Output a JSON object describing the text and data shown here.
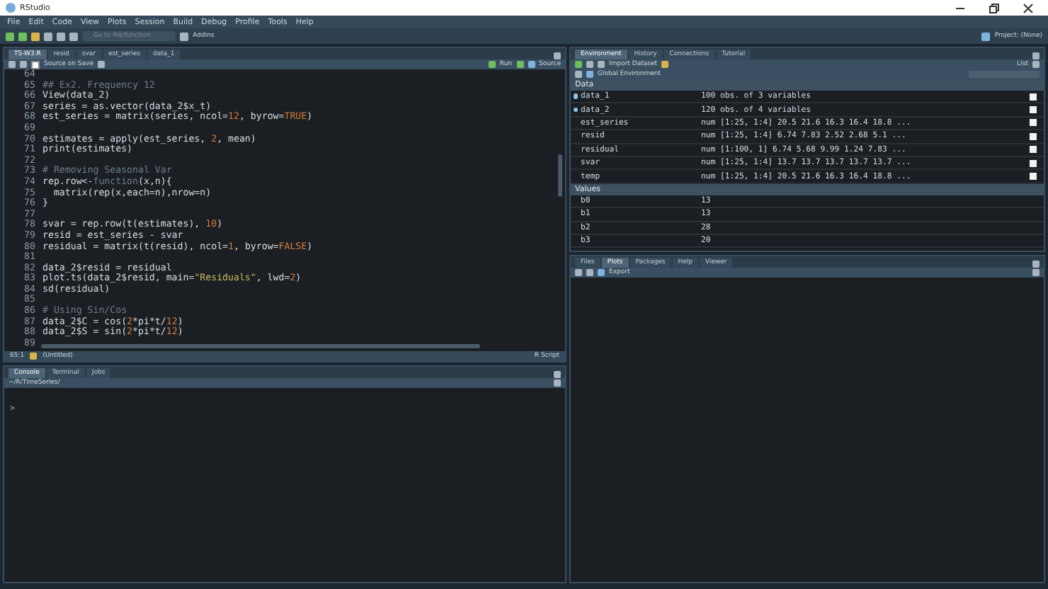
{
  "window": {
    "title": "RStudio"
  },
  "menu": [
    "File",
    "Edit",
    "Code",
    "View",
    "Plots",
    "Session",
    "Build",
    "Debug",
    "Profile",
    "Tools",
    "Help"
  ],
  "toolbar": {
    "goto_placeholder": "Go to file/function",
    "addins": "Addins",
    "project": "Project: (None)"
  },
  "editor": {
    "tabs": [
      {
        "label": "TS-W3.R",
        "selected": true
      },
      {
        "label": "resid",
        "selected": false
      },
      {
        "label": "svar",
        "selected": false
      },
      {
        "label": "est_series",
        "selected": false
      },
      {
        "label": "data_1",
        "selected": false
      }
    ],
    "source_on_save": "Source on Save",
    "source_on_save_checked": false,
    "run": "Run",
    "source": "Source",
    "lines": [
      {
        "n": "64"
      },
      {
        "n": "65",
        "seg": [
          {
            "t": "## Ex2. Frequency 12",
            "kind": "comment"
          }
        ]
      },
      {
        "n": "66",
        "seg": [
          {
            "t": "View(data_2)",
            "kind": "code"
          }
        ]
      },
      {
        "n": "67",
        "seg": [
          {
            "t": "series = as.vector(data_2$x_t)",
            "kind": "code"
          }
        ]
      },
      {
        "n": "68",
        "seg": [
          {
            "t": "est_series = matrix(series, ncol=",
            "kind": "code"
          },
          {
            "t": "12",
            "kind": "number"
          },
          {
            "t": ", byrow=",
            "kind": "code"
          },
          {
            "t": "TRUE",
            "kind": "constant"
          },
          {
            "t": ")",
            "kind": "code"
          }
        ]
      },
      {
        "n": "69"
      },
      {
        "n": "70",
        "seg": [
          {
            "t": "estimates = apply(est_series, ",
            "kind": "code"
          },
          {
            "t": "2",
            "kind": "number"
          },
          {
            "t": ", mean)",
            "kind": "code"
          }
        ]
      },
      {
        "n": "71",
        "seg": [
          {
            "t": "print(estimates)",
            "kind": "code"
          }
        ]
      },
      {
        "n": "72"
      },
      {
        "n": "73",
        "seg": [
          {
            "t": "# Removing Seasonal Var",
            "kind": "comment"
          }
        ]
      },
      {
        "n": "74",
        "seg": [
          {
            "t": "rep.row<-",
            "kind": "code"
          },
          {
            "t": "function",
            "kind": "comment"
          },
          {
            "t": "(x,n){",
            "kind": "code"
          }
        ]
      },
      {
        "n": "75",
        "seg": [
          {
            "t": "  matrix(rep(x,each=n),nrow=n)",
            "kind": "code"
          }
        ]
      },
      {
        "n": "76",
        "seg": [
          {
            "t": "}",
            "kind": "code"
          }
        ]
      },
      {
        "n": "77"
      },
      {
        "n": "78",
        "seg": [
          {
            "t": "svar = rep.row(t(estimates), ",
            "kind": "code"
          },
          {
            "t": "10",
            "kind": "number"
          },
          {
            "t": ")",
            "kind": "code"
          }
        ]
      },
      {
        "n": "79",
        "seg": [
          {
            "t": "resid = est_series - svar",
            "kind": "code"
          }
        ]
      },
      {
        "n": "80",
        "seg": [
          {
            "t": "residual = matrix(t(resid), ncol=",
            "kind": "code"
          },
          {
            "t": "1",
            "kind": "number"
          },
          {
            "t": ", byrow=",
            "kind": "code"
          },
          {
            "t": "FALSE",
            "kind": "constant"
          },
          {
            "t": ")",
            "kind": "code"
          }
        ]
      },
      {
        "n": "81"
      },
      {
        "n": "82",
        "seg": [
          {
            "t": "data_2$resid = residual",
            "kind": "code"
          }
        ]
      },
      {
        "n": "83",
        "seg": [
          {
            "t": "plot.ts(data_2$resid, main=",
            "kind": "code"
          },
          {
            "t": "\"Residuals\"",
            "kind": "string"
          },
          {
            "t": ", lwd=",
            "kind": "code"
          },
          {
            "t": "2",
            "kind": "number"
          },
          {
            "t": ")",
            "kind": "code"
          }
        ]
      },
      {
        "n": "84",
        "seg": [
          {
            "t": "sd(residual)",
            "kind": "code"
          }
        ]
      },
      {
        "n": "85"
      },
      {
        "n": "86",
        "seg": [
          {
            "t": "# Using Sin/Cos",
            "kind": "comment"
          }
        ]
      },
      {
        "n": "87",
        "seg": [
          {
            "t": "data_2$C = cos(",
            "kind": "code"
          },
          {
            "t": "2",
            "kind": "number"
          },
          {
            "t": "*pi*t/",
            "kind": "code"
          },
          {
            "t": "12",
            "kind": "number"
          },
          {
            "t": ")",
            "kind": "code"
          }
        ]
      },
      {
        "n": "88",
        "seg": [
          {
            "t": "data_2$S = sin(",
            "kind": "code"
          },
          {
            "t": "2",
            "kind": "number"
          },
          {
            "t": "*pi*t/",
            "kind": "code"
          },
          {
            "t": "12",
            "kind": "number"
          },
          {
            "t": ")",
            "kind": "code"
          }
        ]
      },
      {
        "n": "89"
      }
    ],
    "status": {
      "position": "65:1",
      "scope": "(Untitled)",
      "filetype": "R Script"
    }
  },
  "console": {
    "tabs": [
      {
        "label": "Console",
        "selected": true
      },
      {
        "label": "Terminal",
        "selected": false
      },
      {
        "label": "Jobs",
        "selected": false
      }
    ],
    "path": "~/R/TimeSeries/",
    "prompt": ">"
  },
  "environment": {
    "tabs": [
      {
        "label": "Environment",
        "selected": true
      },
      {
        "label": "History",
        "selected": false
      },
      {
        "label": "Connections",
        "selected": false
      },
      {
        "label": "Tutorial",
        "selected": false
      }
    ],
    "import": "Import Dataset",
    "list": "List",
    "scope": "Global Environment",
    "data_header": "Data",
    "data": [
      {
        "name": "data_1",
        "value": "100 obs. of 3 variables",
        "kind": "dataframe"
      },
      {
        "name": "data_2",
        "value": "120 obs. of 4 variables",
        "kind": "dataframe"
      },
      {
        "name": "est_series",
        "value": "num [1:25, 1:4] 20.5 21.6 16.3 16.4 18.8 ...",
        "kind": "matrix"
      },
      {
        "name": "resid",
        "value": "num [1:25, 1:4] 6.74 7.83 2.52 2.68 5.1 ...",
        "kind": "matrix"
      },
      {
        "name": "residual",
        "value": "num [1:100, 1] 6.74 5.68 9.99 1.24 7.83 ...",
        "kind": "matrix"
      },
      {
        "name": "svar",
        "value": "num [1:25, 1:4] 13.7 13.7 13.7 13.7 13.7 ...",
        "kind": "matrix"
      },
      {
        "name": "temp",
        "value": "num [1:25, 1:4] 20.5 21.6 16.3 16.4 18.8 ...",
        "kind": "matrix"
      }
    ],
    "values_header": "Values",
    "values": [
      {
        "name": "b0",
        "value": "13"
      },
      {
        "name": "b1",
        "value": "13"
      },
      {
        "name": "b2",
        "value": "28"
      },
      {
        "name": "b3",
        "value": "20"
      }
    ]
  },
  "files": {
    "tabs": [
      {
        "label": "Files",
        "selected": false
      },
      {
        "label": "Plots",
        "selected": true
      },
      {
        "label": "Packages",
        "selected": false
      },
      {
        "label": "Help",
        "selected": false
      },
      {
        "label": "Viewer",
        "selected": false
      }
    ],
    "export": "Export"
  }
}
